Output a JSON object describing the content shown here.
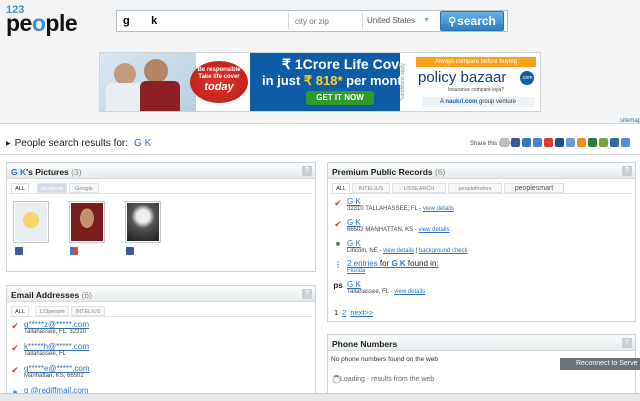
{
  "header": {
    "logo_num": "123",
    "logo_word_1": "pe",
    "logo_word_o": "o",
    "logo_word_2": "ple",
    "query": "g       k",
    "location_placeholder": "city or zip",
    "country": "United States",
    "search_label": "search"
  },
  "banner": {
    "badge_line1": "Be responsible",
    "badge_line2": "Take life cover",
    "badge_line3": "today",
    "line1": "₹ 1Crore  Life Cover",
    "line2_pre": "in just ",
    "line2_amt": "₹ 818*",
    "line2_post": " per month.",
    "cta": "GET IT NOW",
    "side_text": "*conditions apply",
    "right_top": "Always compare before buying",
    "brand": "policy bazaar",
    "brand_badge": ".com",
    "tagline": "Insurance compare kiya?",
    "venture_pre": "A ",
    "venture_brand": "naukri.com",
    "venture_post": " group venture"
  },
  "sitemap": "sitemap",
  "results": {
    "label": "People search results for:",
    "name": "G        K",
    "share_label": "Share this search"
  },
  "pictures": {
    "name": "G        K",
    "title_suffix": "'s Pictures",
    "count": "(3)",
    "tabs": [
      "ALL",
      "facebook",
      "Google"
    ]
  },
  "emails": {
    "title": "Email Addresses",
    "count": "(6)",
    "tabs": [
      "ALL",
      "123people",
      "INTELIUS"
    ],
    "items": [
      {
        "email": "g*****z@*****.com",
        "location": "Tallahassee, FL, 32310"
      },
      {
        "email": "k*****h@*****.com",
        "location": "Tallahassee, FL"
      },
      {
        "email": "g*****e@*****.com",
        "location": "Manhattan, KS, 66502"
      },
      {
        "email": "g        @rediffmail.com",
        "location": ""
      }
    ]
  },
  "records": {
    "title": "Premium Public Records",
    "count": "(6)",
    "tabs": [
      "ALL",
      "INTELIUS",
      "USSEARCH",
      "peoplefinders",
      "peoplesmart"
    ],
    "items": [
      {
        "name": "G        K",
        "detail": "32310 TALLAHASSEE, FL - ",
        "link": "view details",
        "link2": ""
      },
      {
        "name": "G        K",
        "detail": "66502 MANHATTAN, KS - ",
        "link": "view details",
        "link2": ""
      },
      {
        "name": "G        K",
        "detail": "Lincoln, NE - ",
        "link": "view details",
        "link2": "background check"
      },
      {
        "name": "2 entries",
        "detail": "",
        "link": "Florida",
        "link2": ""
      },
      {
        "name": "G        K",
        "detail": "Tallahassee, FL - ",
        "link": "view details",
        "link2": ""
      }
    ],
    "entries_for": " for ",
    "entries_name": "G        K",
    "entries_found": " found in:",
    "divider": " | ",
    "pager_current": "1",
    "pager_page2": "2",
    "pager_next": "next>>"
  },
  "phones": {
    "title": "Phone Numbers",
    "empty": "No phone numbers found on the web",
    "loading": "Loading - results from the web"
  },
  "reconnect": "Reconnect to Serve",
  "colors": {
    "accent": "#2e74c0",
    "brand_blue": "#3b8fd4",
    "header_bg": "#f2f4f5"
  }
}
